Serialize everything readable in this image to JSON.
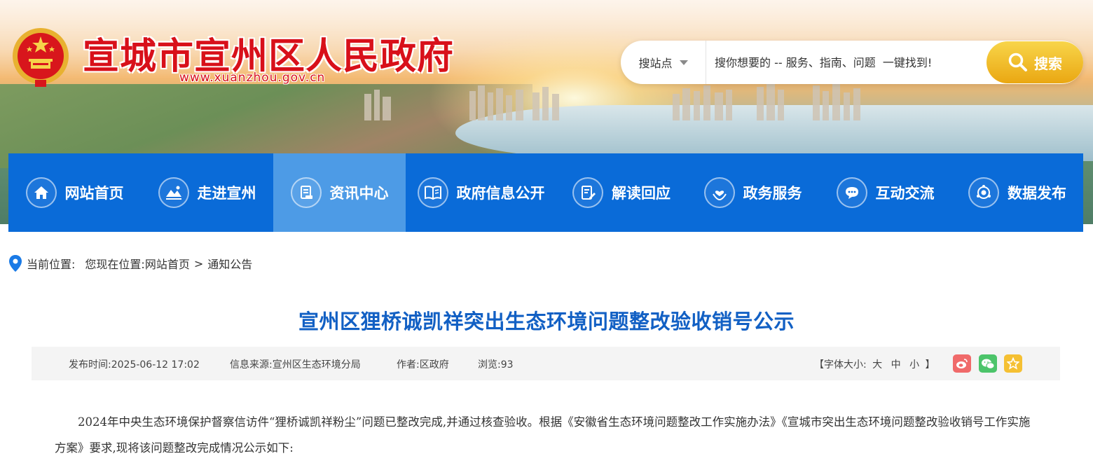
{
  "header": {
    "site_title": "宣城市宣州区人民政府",
    "site_url": "www.xuanzhou.gov.cn"
  },
  "search": {
    "scope_label": "搜站点",
    "placeholder": "搜你想要的 -- 服务、指南、问题  一键找到!",
    "button_label": "搜索"
  },
  "nav": {
    "items": [
      {
        "label": "网站首页",
        "icon": "home-icon"
      },
      {
        "label": "走进宣州",
        "icon": "landscape-icon"
      },
      {
        "label": "资讯中心",
        "icon": "news-icon",
        "active": true
      },
      {
        "label": "政府信息公开",
        "icon": "book-icon"
      },
      {
        "label": "解读回应",
        "icon": "document-edit-icon"
      },
      {
        "label": "政务服务",
        "icon": "service-hands-icon"
      },
      {
        "label": "互动交流",
        "icon": "chat-icon"
      },
      {
        "label": "数据发布",
        "icon": "data-icon"
      }
    ]
  },
  "breadcrumb": {
    "label": "当前位置:",
    "prefix": "您现在位置:",
    "home": "网站首页",
    "separator": ">",
    "current": "通知公告"
  },
  "article": {
    "title": "宣州区狸桥诚凯祥突出生态环境问题整改验收销号公示",
    "publish_time": "发布时间:2025-06-12 17:02",
    "source": "信息来源:宣州区生态环境分局",
    "author": "作者:区政府",
    "views": "浏览:93",
    "font_size_label": "【字体大小:",
    "font_size_options": [
      "大",
      "中",
      "小"
    ],
    "font_size_end": "】",
    "body": "2024年中央生态环境保护督察信访件“狸桥诚凯祥粉尘”问题已整改完成,并通过核查验收。根据《安徽省生态环境问题整改工作实施办法》《宣城市突出生态环境问题整改验收销号工作实施方案》要求,现将该问题整改完成情况公示如下:"
  },
  "share": {
    "items": [
      "weibo-icon",
      "wechat-icon",
      "favorite-icon"
    ],
    "colors": {
      "weibo": "#f06a6a",
      "wechat": "#4cc46a",
      "favorite": "#f5c033"
    }
  },
  "colors": {
    "nav_bg": "#0a6bd8",
    "nav_active": "#4d9be6",
    "title_blue": "#1260c4",
    "brand_red": "#d8101a",
    "search_button": "#f0b81f"
  }
}
